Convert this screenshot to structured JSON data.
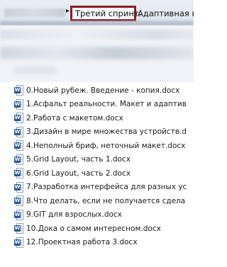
{
  "address_bar": {
    "separator": "▸",
    "current_folder": "Третий спринт.",
    "next_folder": "Адаптивная вер"
  },
  "files": [
    {
      "name": "0.Новый рубеж. Введение  - копия.docx",
      "icon": "word-doc-icon"
    },
    {
      "name": "1.Асфальт реальности. Макет и адаптив",
      "icon": "word-doc-icon"
    },
    {
      "name": "2.Работа с макетом.docx",
      "icon": "word-doc-icon"
    },
    {
      "name": "3.Дизайн в мире множества устройств.d",
      "icon": "word-doc-icon"
    },
    {
      "name": "4.Неполный бриф, неточный макет.docx",
      "icon": "word-doc-icon"
    },
    {
      "name": "5.Grid Layout, часть 1.docx",
      "icon": "word-doc-icon"
    },
    {
      "name": "6.Grid Layout, часть 2.docx",
      "icon": "word-doc-icon"
    },
    {
      "name": "7.Разработка интерфейса для разных ус",
      "icon": "word-doc-icon"
    },
    {
      "name": "8.Что делать, если не получается сдела",
      "icon": "word-doc-icon"
    },
    {
      "name": "9.GIT для взрослых.docx",
      "icon": "word-doc-icon"
    },
    {
      "name": "10.Дока о самом интересном.docx",
      "icon": "word-doc-icon"
    },
    {
      "name": "12.Проектная работа 3.docx",
      "icon": "word-doc-icon"
    }
  ],
  "icon_badge_letter": "W",
  "colors": {
    "highlight_border": "#8b1c24",
    "word_badge": "#2b5797"
  }
}
